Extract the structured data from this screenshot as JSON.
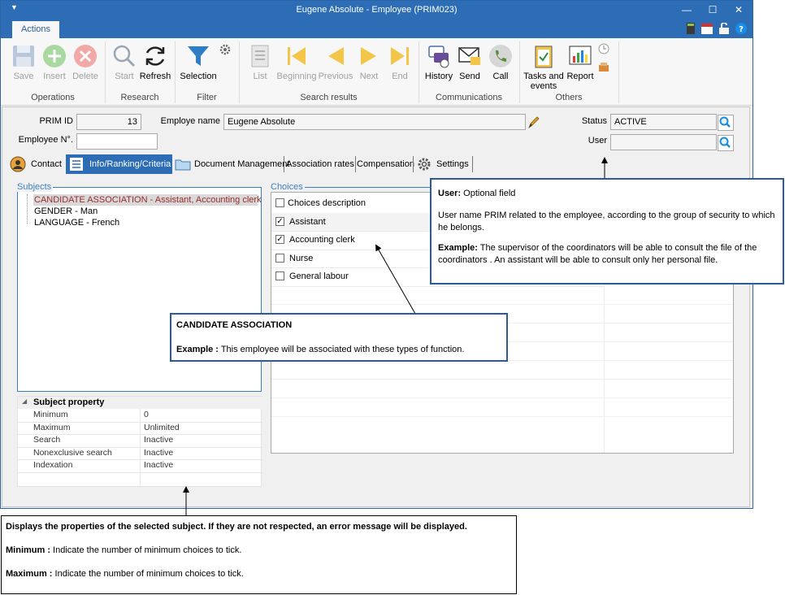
{
  "window": {
    "title": "Eugene Absolute - Employee (PRIM023)"
  },
  "ribbon": {
    "tab": "Actions",
    "buttons": {
      "save": "Save",
      "insert": "Insert",
      "delete": "Delete",
      "start": "Start",
      "refresh": "Refresh",
      "selection": "Selection",
      "list": "List",
      "beginning": "Beginning",
      "previous": "Previous",
      "next": "Next",
      "end": "End",
      "history": "History",
      "send": "Send",
      "call": "Call",
      "tasks_line1": "Tasks and",
      "tasks_line2": "events",
      "report": "Report"
    },
    "groups": {
      "operations": "Operations",
      "research": "Research",
      "filter": "Filter",
      "search_results": "Search results",
      "communications": "Communications",
      "others": "Others"
    }
  },
  "form": {
    "prim_id_label": "PRIM ID",
    "prim_id_value": "13",
    "employee_name_label": "Employe name",
    "employee_name_value": "Eugene Absolute",
    "employee_no_label": "Employee N°.",
    "employee_no_value": "",
    "status_label": "Status",
    "status_value": "ACTIVE",
    "user_label": "User",
    "user_value": ""
  },
  "tabs": {
    "contact": "Contact",
    "info": "Info/Ranking/Criteria",
    "documents": "Document Management",
    "association": "Association rates",
    "compensation": "Compensation",
    "settings": "Settings"
  },
  "subjects": {
    "title": "Subjects",
    "items": [
      "CANDIDATE ASSOCIATION - Assistant, Accounting clerk",
      "GENDER - Man",
      "LANGUAGE - French"
    ]
  },
  "subject_property": {
    "title": "Subject property",
    "rows": [
      {
        "k": "Minimum",
        "v": "0"
      },
      {
        "k": "Maximum",
        "v": "Unlimited"
      },
      {
        "k": "Search",
        "v": "Inactive"
      },
      {
        "k": "Nonexclusive search",
        "v": "Inactive"
      },
      {
        "k": "Indexation",
        "v": "Inactive"
      }
    ]
  },
  "choices": {
    "title": "Choices",
    "header": "Choices description",
    "items": [
      {
        "label": "Assistant",
        "checked": true
      },
      {
        "label": "Accounting clerk",
        "checked": true
      },
      {
        "label": "Nurse",
        "checked": false
      },
      {
        "label": "General labour",
        "checked": false
      }
    ]
  },
  "callouts": {
    "user": {
      "title_bold": "User:",
      "title_rest": " Optional field",
      "para": "User name PRIM related to the employee, according to the group of security to which he belongs.",
      "example_bold": "Example:",
      "example_rest": " The supervisor of the coordinators will be able to consult the file of the coordinators . An assistant will be able to consult only her personal file."
    },
    "candidate": {
      "title": "CANDIDATE ASSOCIATION",
      "example_bold": "Example :",
      "example_rest": " This employee will be associated with these types of function."
    },
    "properties": {
      "title": "Displays the properties of the selected subject. If they are not respected, an error message will be displayed.",
      "min_bold": "Minimum :",
      "min_rest": " Indicate the number of minimum choices to tick.",
      "max_bold": "Maximum :",
      "max_rest": " Indicate the number of minimum choices to tick."
    }
  }
}
